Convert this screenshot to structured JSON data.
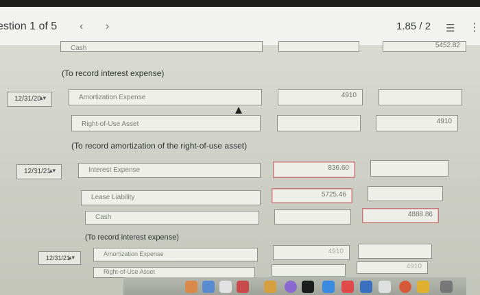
{
  "header": {
    "question_label": "estion 1 of 5",
    "prev_icon": "‹",
    "next_icon": "›",
    "score": "1.85 / 2",
    "list_icon": "☰",
    "more_icon": "⋮"
  },
  "rows": {
    "cash_top": {
      "account": "Cash",
      "credit": "5452.82"
    },
    "note1": "(To record interest expense)",
    "entry2": {
      "date": "12/31/20",
      "debit_account": "Amortization Expense",
      "debit": "4910",
      "credit_account": "Right-of-Use Asset",
      "credit": "4910",
      "note": "(To record amortization of the right-of-use asset)"
    },
    "entry3": {
      "date": "12/31/21",
      "debit_account": "Interest Expense",
      "debit": "836.60",
      "debit2_account": "Lease Liability",
      "debit2": "5725.46",
      "credit_account": "Cash",
      "credit": "4888.86",
      "note": "(To record interest expense)"
    },
    "entry4": {
      "date": "12/31/21",
      "debit_account": "Amortization Expense",
      "debit": "4910",
      "credit_account": "Right-of-Use Asset",
      "credit": "4910"
    }
  },
  "colors": {
    "accent": "#c47a7a",
    "header_bg": "#f2f3f0"
  }
}
